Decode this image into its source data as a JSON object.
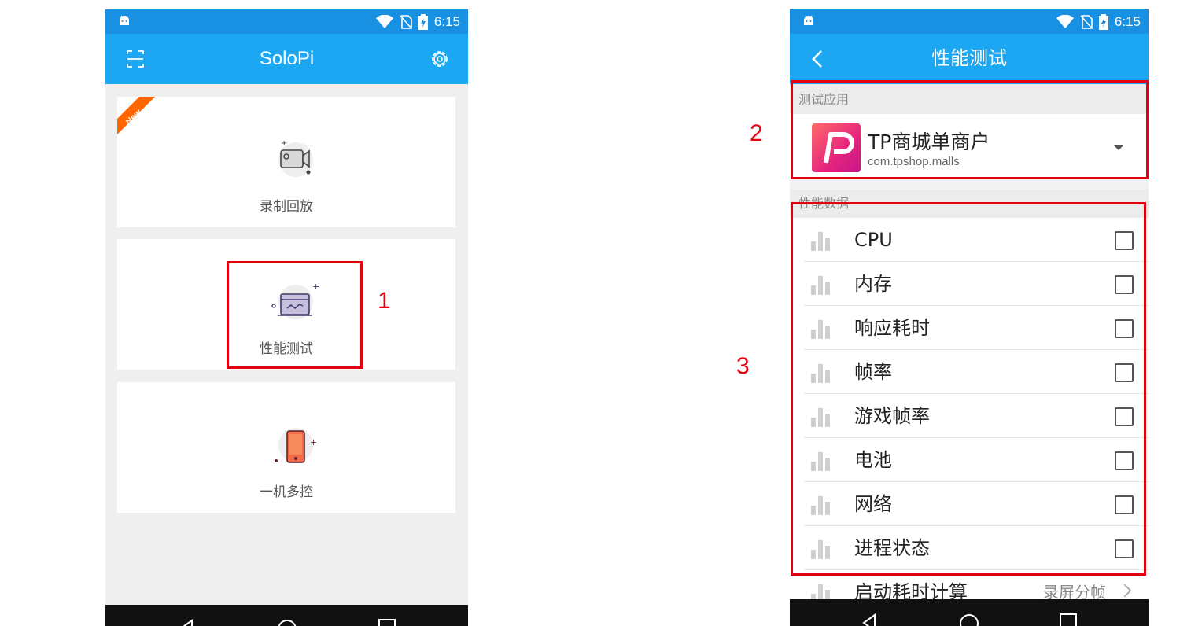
{
  "status_bar": {
    "time": "6:15"
  },
  "left_screen": {
    "app_title": "SoloPi",
    "new_badge": "New",
    "cards": [
      {
        "label": "录制回放",
        "icon": "video-camera-icon"
      },
      {
        "label": "性能测试",
        "icon": "monitor-chart-icon"
      },
      {
        "label": "一机多控",
        "icon": "phone-multi-control-icon"
      }
    ]
  },
  "right_screen": {
    "title": "性能测试",
    "test_app_header": "测试应用",
    "app": {
      "name": "TP商城单商户",
      "package": "com.tpshop.malls"
    },
    "perf_data_header": "性能数据",
    "metrics": [
      {
        "label": "CPU",
        "checked": false
      },
      {
        "label": "内存",
        "checked": false
      },
      {
        "label": "响应耗时",
        "checked": false
      },
      {
        "label": "帧率",
        "checked": false
      },
      {
        "label": "游戏帧率",
        "checked": false
      },
      {
        "label": "电池",
        "checked": false
      },
      {
        "label": "网络",
        "checked": false
      },
      {
        "label": "进程状态",
        "checked": false
      }
    ],
    "startup_item": {
      "label": "启动耗时计算",
      "right_label": "录屏分帧"
    }
  },
  "annotations": {
    "a1": "1",
    "a2": "2",
    "a3": "3"
  },
  "colors": {
    "status_bar": "#1991e2",
    "app_bar": "#1ba7f1",
    "highlight": "#e4000f",
    "new_badge": "#ff6600"
  }
}
